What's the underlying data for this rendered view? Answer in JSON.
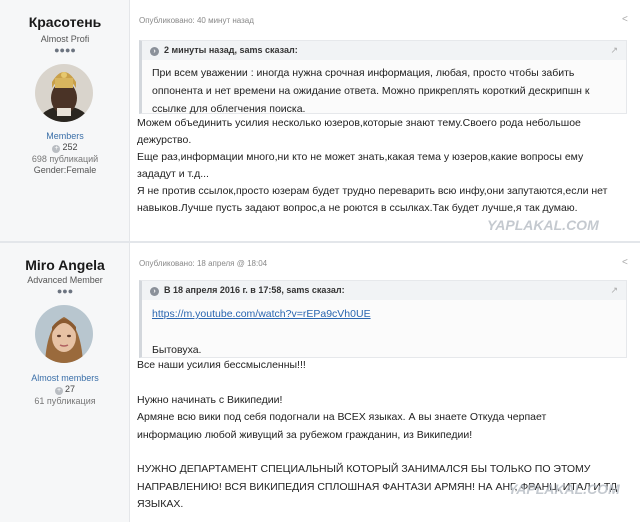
{
  "posts": [
    {
      "author": {
        "name": "Красотень",
        "rank": "Almost Profi",
        "dots": "●●●●",
        "group": "Members",
        "reputation": "252",
        "posts_count": "698 публикаций",
        "gender": "Gender:Female"
      },
      "meta": "Опубликовано: 40 минут назад",
      "quote": {
        "header": "2 минуты назад, sams сказал:",
        "lines": [
          "При всем   уважении : иногда нужна срочная информация, любая, просто чтобы забить",
          "оппонента и нет времени на ожидание ответа. Можно прикреплять короткий дескрипшн к",
          "ссылке для облегчения поиска."
        ]
      },
      "body": [
        "Можем объединить усилия несколько юзеров,которые знают тему.Своего рода небольшое",
        "дежурство.",
        "Еще раз,информации много,ни кто не может знать,какая тема у юзеров,какие вопросы ему",
        "зададут и т.д...",
        "Я не против ссылок,просто юзерам будет трудно переварить всю инфу,они запутаются,если нет",
        "навыков.Лучше пусть задают вопрос,а не роются в ссылках.Так будет лучше,я так думаю."
      ]
    },
    {
      "author": {
        "name": "Miro Angela",
        "rank": "Advanced Member",
        "dots": "●●●",
        "group": "Almost members",
        "reputation": "27",
        "posts_count": "61 публикация"
      },
      "meta": "Опубликовано: 18 апреля @ 18:04",
      "quote": {
        "header": "В 18 апреля 2016 г. в 17:58, sams сказал:",
        "link": "https://m.youtube.com/watch?v=rEPa9cVh0UE",
        "text": "Бытовуха."
      },
      "body": [
        "Все наши усилия бессмысленны!!!",
        "",
        "Нужно начинать с Википедии!",
        "Армяне всю вики под себя подогнали на ВСЕХ языках. А вы знаете Откуда черпает",
        "информацию любой живущий за рубежом гражданин, из Википедии!",
        "",
        "НУЖНО ДЕПАРТАМЕНТ СПЕЦИАЛЬНЫЙ КОТОРЫЙ ЗАНИМАЛСЯ БЫ ТОЛЬКО ПО ЭТОМУ",
        "НАПРАВЛЕНИЮ! ВСЯ ВИКИПЕДИЯ СПЛОШНАЯ ФАНТАЗИ АРМЯН! НА АНГ, ФРАНЦ, ИТАЛ И ТД",
        "ЯЗЫКАХ."
      ]
    }
  ],
  "watermark": "YAPLAKAL.COM",
  "icons": {
    "share": "share-icon",
    "quote": "quote-icon",
    "reputation": "plus-icon"
  }
}
